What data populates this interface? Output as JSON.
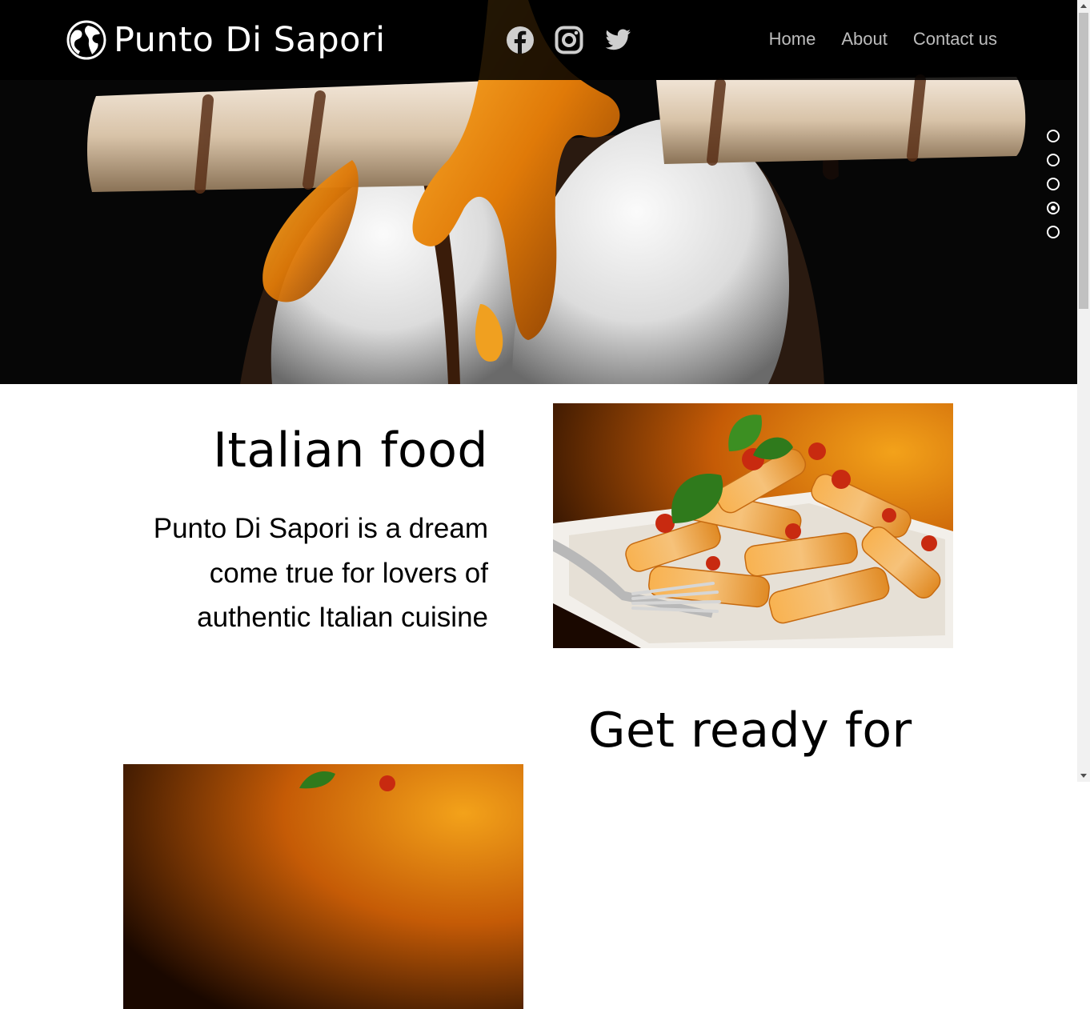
{
  "brand": {
    "name": "Punto Di Sapori",
    "logo_icon": "globe-icon"
  },
  "social_links": [
    {
      "name": "facebook",
      "icon": "facebook-icon"
    },
    {
      "name": "instagram",
      "icon": "instagram-icon"
    },
    {
      "name": "twitter",
      "icon": "twitter-icon"
    }
  ],
  "nav": {
    "home": "Home",
    "about": "About",
    "contact": "Contact us"
  },
  "slider": {
    "slide_count": 5,
    "active_slide": 4
  },
  "sections": {
    "italian": {
      "title": "Italian food",
      "description": "Punto Di Sapori is a dream come true for lovers of authentic Italian cuisine"
    },
    "second": {
      "title": "Get ready for"
    }
  },
  "colors": {
    "nav_bg": "#000000",
    "nav_link": "#bdbdbd",
    "text": "#000000",
    "page_bg": "#ffffff"
  }
}
